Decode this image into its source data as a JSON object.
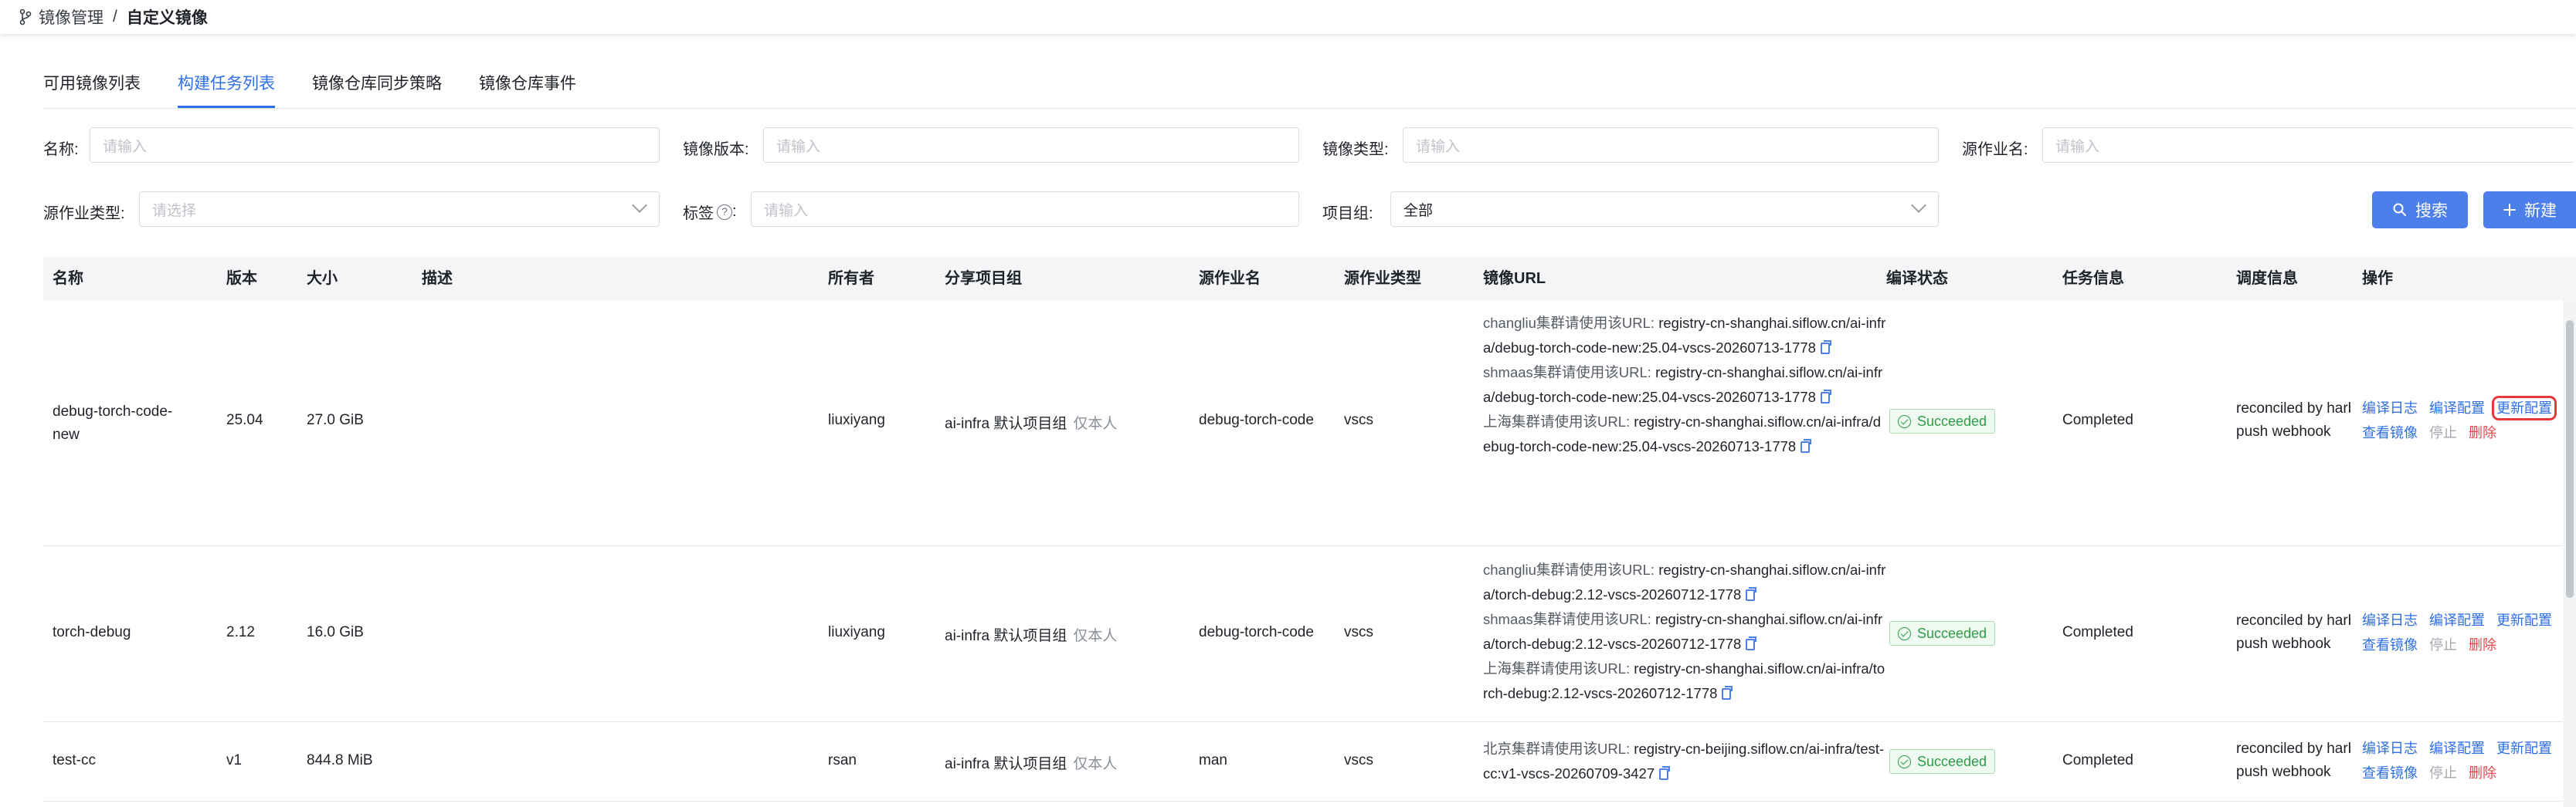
{
  "breadcrumb": {
    "parent": "镜像管理",
    "separator": "/",
    "current": "自定义镜像"
  },
  "tabs": [
    {
      "label": "可用镜像列表",
      "active": false
    },
    {
      "label": "构建任务列表",
      "active": true
    },
    {
      "label": "镜像仓库同步策略",
      "active": false
    },
    {
      "label": "镜像仓库事件",
      "active": false
    }
  ],
  "filters": {
    "name": {
      "label": "名称:",
      "placeholder": "请输入"
    },
    "version": {
      "label": "镜像版本:",
      "placeholder": "请输入"
    },
    "type": {
      "label": "镜像类型:",
      "placeholder": "请输入"
    },
    "source_job": {
      "label": "源作业名:",
      "placeholder": "请输入"
    },
    "source_job_type": {
      "label": "源作业类型:",
      "placeholder": "请选择"
    },
    "tag": {
      "label": "标签",
      "help": "?",
      "colon": ":",
      "placeholder": "请输入"
    },
    "project_group": {
      "label": "项目组:",
      "value": "全部"
    }
  },
  "buttons": {
    "search": "搜索",
    "create": "新建"
  },
  "table": {
    "headers": {
      "name": "名称",
      "version": "版本",
      "size": "大小",
      "description": "描述",
      "owner": "所有者",
      "share": "分享项目组",
      "source_job": "源作业名",
      "source_job_type": "源作业类型",
      "image_url": "镜像URL",
      "build_status": "编译状态",
      "task_info": "任务信息",
      "schedule": "调度信息",
      "actions": "操作"
    },
    "rows": [
      {
        "name_line1": "debug-torch-code-",
        "name_line2": "new",
        "version": "25.04",
        "size": "27.0 GiB",
        "owner": "liuxiyang",
        "share": "ai-infra 默认项目组",
        "share_tag": "仅本人",
        "source_job": "debug-torch-code",
        "source_job_type": "vscs",
        "urls": [
          {
            "prefix": "changliu集群请使用该URL:",
            "url": "registry-cn-shanghai.siflow.cn/ai-infra/debug-torch-code-new:25.04-vscs-20260713-1778"
          },
          {
            "prefix": "shmaas集群请使用该URL:",
            "url": "registry-cn-shanghai.siflow.cn/ai-infra/debug-torch-code-new:25.04-vscs-20260713-1778"
          },
          {
            "prefix": "上海集群请使用该URL:",
            "url": "registry-cn-shanghai.siflow.cn/ai-infra/debug-torch-code-new:25.04-vscs-20260713-1778"
          }
        ],
        "status": "Succeeded",
        "task_info": "Completed",
        "schedule_line1": "reconciled by harbor",
        "schedule_line2": "push webhook",
        "actions": {
          "log": "编译日志",
          "config": "编译配置",
          "update": "更新配置",
          "view": "查看镜像",
          "stop": "停止",
          "delete": "删除"
        }
      },
      {
        "name_line1": "torch-debug",
        "name_line2": "",
        "version": "2.12",
        "size": "16.0 GiB",
        "owner": "liuxiyang",
        "share": "ai-infra 默认项目组",
        "share_tag": "仅本人",
        "source_job": "debug-torch-code",
        "source_job_type": "vscs",
        "urls": [
          {
            "prefix": "changliu集群请使用该URL:",
            "url": "registry-cn-shanghai.siflow.cn/ai-infra/torch-debug:2.12-vscs-20260712-1778"
          },
          {
            "prefix": "shmaas集群请使用该URL:",
            "url": "registry-cn-shanghai.siflow.cn/ai-infra/torch-debug:2.12-vscs-20260712-1778"
          },
          {
            "prefix": "上海集群请使用该URL:",
            "url": "registry-cn-shanghai.siflow.cn/ai-infra/torch-debug:2.12-vscs-20260712-1778"
          }
        ],
        "status": "Succeeded",
        "task_info": "Completed",
        "schedule_line1": "reconciled by harbor",
        "schedule_line2": "push webhook",
        "actions": {
          "log": "编译日志",
          "config": "编译配置",
          "update": "更新配置",
          "view": "查看镜像",
          "stop": "停止",
          "delete": "删除"
        }
      },
      {
        "name_line1": "test-cc",
        "name_line2": "",
        "version": "v1",
        "size": "844.8 MiB",
        "owner": "rsan",
        "share": "ai-infra 默认项目组",
        "share_tag": "仅本人",
        "source_job": "man",
        "source_job_type": "vscs",
        "urls": [
          {
            "prefix": "北京集群请使用该URL:",
            "url": "registry-cn-beijing.siflow.cn/ai-infra/test-cc:v1-vscs-20260709-3427"
          }
        ],
        "status": "Succeeded",
        "task_info": "Completed",
        "schedule_line1": "reconciled by harbor",
        "schedule_line2": "push webhook",
        "actions": {
          "log": "编译日志",
          "config": "编译配置",
          "update": "更新配置",
          "view": "查看镜像",
          "stop": "停止",
          "delete": "删除"
        }
      }
    ]
  }
}
